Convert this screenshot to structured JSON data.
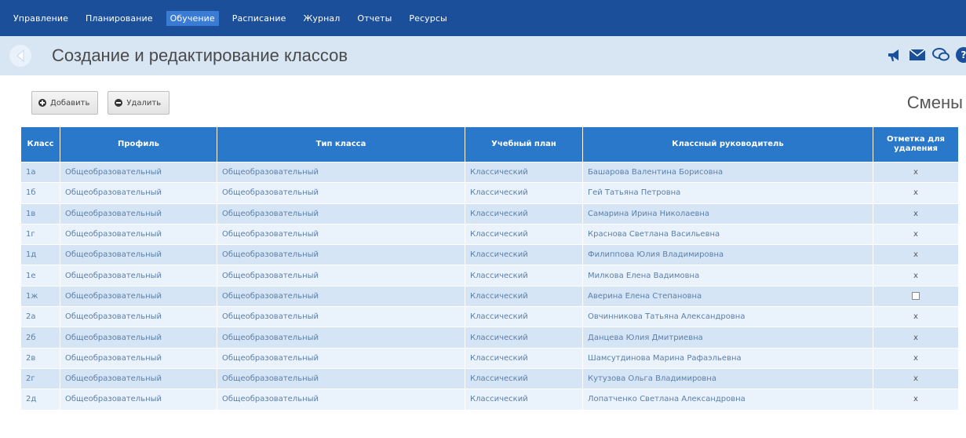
{
  "nav": {
    "items": [
      "Управление",
      "Планирование",
      "Обучение",
      "Расписание",
      "Журнал",
      "Отчеты",
      "Ресурсы"
    ],
    "active": "Обучение"
  },
  "header": {
    "title": "Создание и редактирование классов",
    "icons": [
      "back-arrow-icon",
      "megaphone-icon",
      "mail-icon",
      "chat-icon",
      "help-icon"
    ]
  },
  "toolbar": {
    "add_label": "Добавить",
    "delete_label": "Удалить",
    "shifts_label": "Смены"
  },
  "table": {
    "columns": [
      "Класс",
      "Профиль",
      "Тип класса",
      "Учебный план",
      "Классный руководитель",
      "Отметка для удаления"
    ],
    "rows": [
      {
        "cls": "1а",
        "profile": "Общеобразовательный",
        "type": "Общеобразовательный",
        "plan": "Классический",
        "teacher": "Башарова Валентина Борисовна",
        "mark": "x"
      },
      {
        "cls": "1б",
        "profile": "Общеобразовательный",
        "type": "Общеобразовательный",
        "plan": "Классический",
        "teacher": "Гей Татьяна Петровна",
        "mark": "x"
      },
      {
        "cls": "1в",
        "profile": "Общеобразовательный",
        "type": "Общеобразовательный",
        "plan": "Классический",
        "teacher": "Самарина Ирина Николаевна",
        "mark": "x"
      },
      {
        "cls": "1г",
        "profile": "Общеобразовательный",
        "type": "Общеобразовательный",
        "plan": "Классический",
        "teacher": "Краснова Светлана Васильевна",
        "mark": "x"
      },
      {
        "cls": "1д",
        "profile": "Общеобразовательный",
        "type": "Общеобразовательный",
        "plan": "Классический",
        "teacher": "Филиппова Юлия Владимировна",
        "mark": "x"
      },
      {
        "cls": "1е",
        "profile": "Общеобразовательный",
        "type": "Общеобразовательный",
        "plan": "Классический",
        "teacher": "Милкова Елена Вадимовна",
        "mark": "x"
      },
      {
        "cls": "1ж",
        "profile": "Общеобразовательный",
        "type": "Общеобразовательный",
        "plan": "Классический",
        "teacher": "Аверина Елена Степановна",
        "mark": "checkbox"
      },
      {
        "cls": "2а",
        "profile": "Общеобразовательный",
        "type": "Общеобразовательный",
        "plan": "Классический",
        "teacher": "Овчинникова Татьяна Александровна",
        "mark": "x"
      },
      {
        "cls": "2б",
        "profile": "Общеобразовательный",
        "type": "Общеобразовательный",
        "plan": "Классический",
        "teacher": "Данцева Юлия Дмитриевна",
        "mark": "x"
      },
      {
        "cls": "2в",
        "profile": "Общеобразовательный",
        "type": "Общеобразовательный",
        "plan": "Классический",
        "teacher": "Шамсутдинова Марина Рафаэльевна",
        "mark": "x"
      },
      {
        "cls": "2г",
        "profile": "Общеобразовательный",
        "type": "Общеобразовательный",
        "plan": "Классический",
        "teacher": "Кутузова Ольга Владимировна",
        "mark": "x"
      },
      {
        "cls": "2д",
        "profile": "Общеобразовательный",
        "type": "Общеобразовательный",
        "plan": "Классический",
        "teacher": "Лопатченко Светлана Александровна",
        "mark": "x"
      }
    ]
  },
  "colors": {
    "nav_bg": "#1b4f9a",
    "nav_active": "#3a7bd5",
    "title_bar_bg": "#d8e6f4",
    "table_header_bg": "#2a78c9",
    "row_odd": "#d6e5f5",
    "row_even": "#eaf2fb",
    "cell_text": "#5b7fa8"
  }
}
